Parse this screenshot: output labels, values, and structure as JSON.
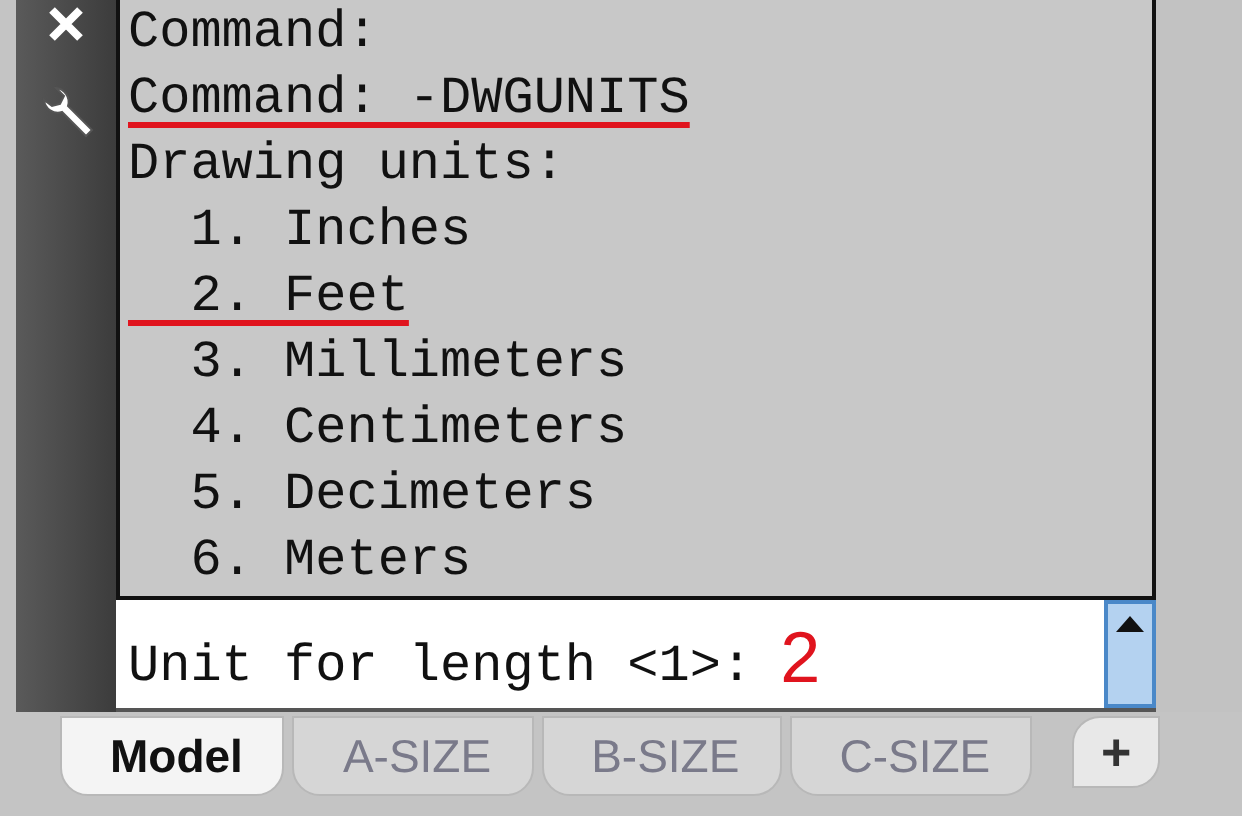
{
  "history": [
    {
      "text": "Command:",
      "underlined": false
    },
    {
      "text": "Command: -DWGUNITS",
      "underlined": true
    },
    {
      "text": "Drawing units:",
      "underlined": false
    },
    {
      "text": "  1. Inches",
      "underlined": false
    },
    {
      "text": "  2. Feet",
      "underlined": true
    },
    {
      "text": "  3. Millimeters",
      "underlined": false
    },
    {
      "text": "  4. Centimeters",
      "underlined": false
    },
    {
      "text": "  5. Decimeters",
      "underlined": false
    },
    {
      "text": "  6. Meters",
      "underlined": false
    }
  ],
  "input": {
    "prompt": "Unit for length <1>:",
    "value": "2"
  },
  "tabs": [
    {
      "label": "Model",
      "selected": true
    },
    {
      "label": "A-SIZE",
      "selected": false
    },
    {
      "label": "B-SIZE",
      "selected": false
    },
    {
      "label": "C-SIZE",
      "selected": false
    }
  ],
  "add_tab": {
    "label": "+"
  }
}
